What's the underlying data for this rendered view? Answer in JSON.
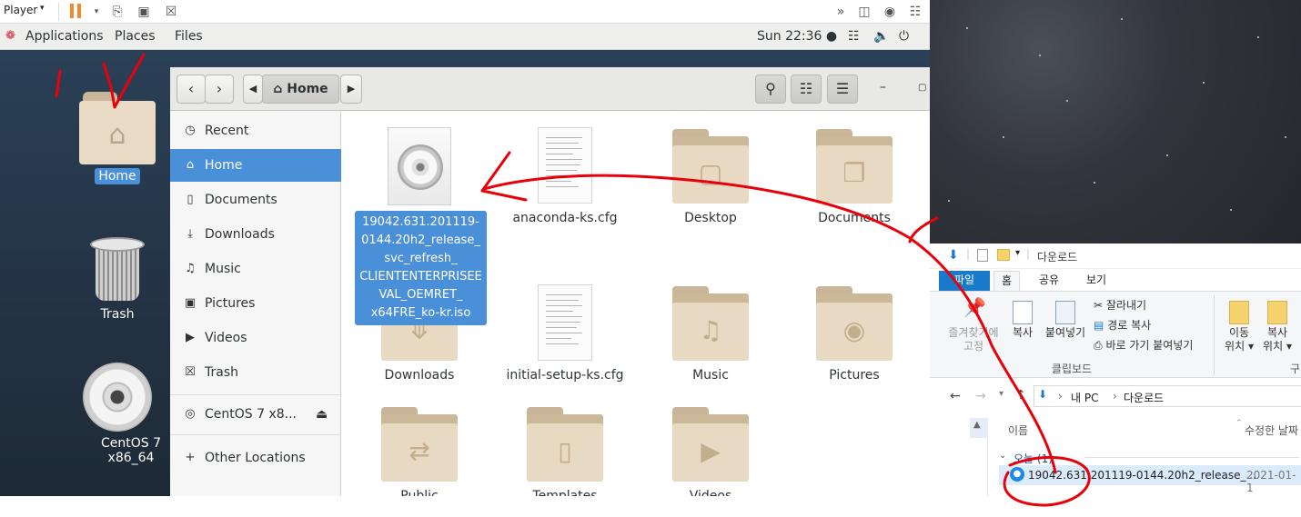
{
  "player": {
    "label": "Player",
    "caret": "▾",
    "toolbar_icons": [
      "pause-icon",
      "send-keys-icon",
      "fit-icon",
      "unity-icon"
    ],
    "right_icons": [
      "forward-icon",
      "disk-icon",
      "cd-icon",
      "usb-icon"
    ]
  },
  "gnome_top": {
    "applications": "Applications",
    "places": "Places",
    "files": "Files",
    "clock": "Sun 22:36 ●",
    "tray_icons": [
      "network-icon",
      "volume-icon",
      "power-icon"
    ]
  },
  "desktop": {
    "icons": [
      {
        "label": "Home",
        "selected": true
      },
      {
        "label": "Trash",
        "selected": false
      },
      {
        "label": "CentOS 7 x86_64",
        "selected": false
      }
    ]
  },
  "files_window": {
    "path_button": "Home",
    "sidebar": [
      {
        "label": "Recent",
        "icon": "clock-icon",
        "glyph": "◷"
      },
      {
        "label": "Home",
        "icon": "home-icon",
        "glyph": "⌂",
        "active": true
      },
      {
        "label": "Documents",
        "icon": "document-icon",
        "glyph": "▯"
      },
      {
        "label": "Downloads",
        "icon": "download-icon",
        "glyph": "⤓"
      },
      {
        "label": "Music",
        "icon": "music-icon",
        "glyph": "♫"
      },
      {
        "label": "Pictures",
        "icon": "camera-icon",
        "glyph": "▣"
      },
      {
        "label": "Videos",
        "icon": "video-icon",
        "glyph": "▶"
      },
      {
        "label": "Trash",
        "icon": "trash-icon",
        "glyph": "☒"
      },
      {
        "label": "CentOS 7 x8...",
        "icon": "disc-icon",
        "glyph": "◎"
      },
      {
        "label": "Other Locations",
        "icon": "plus-icon",
        "glyph": "+"
      }
    ],
    "items": [
      {
        "label": "19042.631.201119-0144.20h2_release_svc_refresh_CLIENTENTERPRISEEVAL_OEMRET_x64FRE_ko-kr.iso",
        "kind": "iso",
        "selected": true
      },
      {
        "label": "anaconda-ks.cfg",
        "kind": "doc"
      },
      {
        "label": "Desktop",
        "kind": "folder"
      },
      {
        "label": "Documents",
        "kind": "folder"
      },
      {
        "label": "Downloads",
        "kind": "folder"
      },
      {
        "label": "initial-setup-ks.cfg",
        "kind": "doc"
      },
      {
        "label": "Music",
        "kind": "folder"
      },
      {
        "label": "Pictures",
        "kind": "folder"
      },
      {
        "label": "Public",
        "kind": "folder"
      },
      {
        "label": "Templates",
        "kind": "folder"
      },
      {
        "label": "Videos",
        "kind": "folder"
      }
    ],
    "selected_label_lines": [
      "19042.631.201119-",
      "0144.20h2_release_",
      "svc_refresh_",
      "CLIENTENTERPRISEE",
      "VAL_OEMRET_",
      "x64FRE_ko-kr.iso"
    ]
  },
  "explorer": {
    "title": "다운로드",
    "tabs": [
      "파일",
      "홈",
      "공유",
      "보기"
    ],
    "ribbon": {
      "pin_line1": "즐겨찾기에",
      "pin_line2": "고정",
      "copy": "복사",
      "paste": "붙여넣기",
      "cut": "잘라내기",
      "copy_path": "경로 복사",
      "paste_shortcut": "바로 가기 붙여넣기",
      "move_line1": "이동",
      "move_line2": "위치",
      "copyto_line1": "복사",
      "copyto_line2": "위치",
      "clipboard_group": "클립보드",
      "organize_group": "구"
    },
    "address": {
      "pc": "내 PC",
      "folder": "다운로드"
    },
    "columns": {
      "name": "이름",
      "modified": "수정한 날짜"
    },
    "group": "오늘 (1)",
    "file_row": {
      "name": "19042.631.201119-0144.20h2_release_...",
      "date": "2021-01-1"
    }
  },
  "annotations": {
    "number_one": "1"
  },
  "colors": {
    "accent": "#4a90d9",
    "annotation": "#e8000a",
    "windows_blue": "#1979ca"
  }
}
